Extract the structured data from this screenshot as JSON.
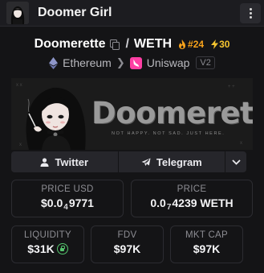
{
  "titlebar": {
    "title": "Doomer Girl",
    "avatar_icon": "doomer-girl-avatar-icon",
    "menu_icon": "vertical-dots-icon"
  },
  "pair": {
    "base": "Doomerette",
    "separator": "/",
    "quote": "WETH",
    "rank": "#24",
    "rank_icon": "flame-icon",
    "boost": "30",
    "boost_icon": "lightning-icon"
  },
  "chain": {
    "chain_name": "Ethereum",
    "chain_icon": "ethereum-icon",
    "dex_name": "Uniswap",
    "dex_icon": "uniswap-icon",
    "version": "V2"
  },
  "banner": {
    "title": "Doomerette",
    "tagline": "NOT HAPPY. NOT SAD. JUST HERE."
  },
  "socials": {
    "twitter_label": "Twitter",
    "telegram_label": "Telegram"
  },
  "stats": {
    "price_usd_label": "PRICE USD",
    "price_usd_prefix": "$0.0",
    "price_usd_sub": "4",
    "price_usd_rest": "9771",
    "price_label": "PRICE",
    "price_prefix": "0.0",
    "price_sub": "7",
    "price_rest": "4239 WETH",
    "liquidity_label": "LIQUIDITY",
    "liquidity_value": "$31K",
    "fdv_label": "FDV",
    "fdv_value": "$97K",
    "mktcap_label": "MKT CAP",
    "mktcap_value": "$97K"
  },
  "colors": {
    "background": "#141416",
    "rank": "#f7a21b",
    "boost": "#f4c430",
    "lock": "#55c46d"
  }
}
